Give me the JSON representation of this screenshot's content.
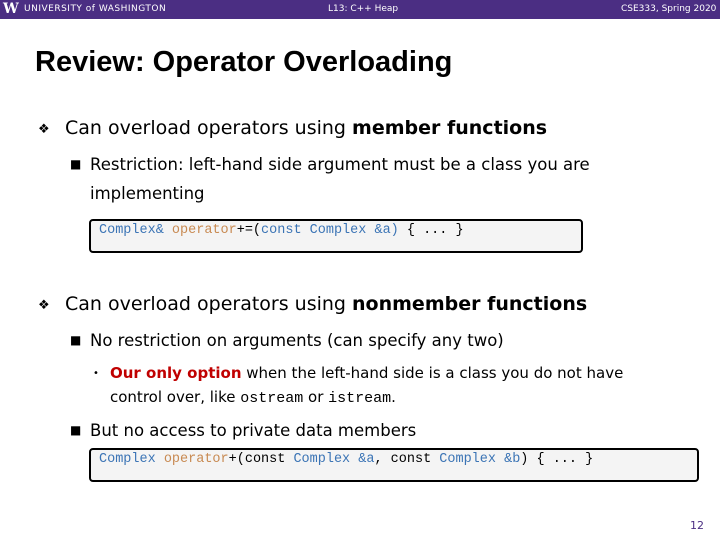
{
  "header": {
    "logo": "W",
    "university": "UNIVERSITY of WASHINGTON",
    "lecture": "L13: C++ Heap",
    "course": "CSE333, Spring 2020"
  },
  "title": "Review: Operator Overloading",
  "bullet1": {
    "pre": "Can overload operators using ",
    "bold": "member functions"
  },
  "bullet1_sub": "Restriction: left-hand side argument must be a class you are implementing",
  "code1": [
    {
      "t": "Complex&",
      "c": "k"
    },
    {
      "t": " ",
      "c": "p"
    },
    {
      "t": "operator",
      "c": "o"
    },
    {
      "t": "+=(",
      "c": "p"
    },
    {
      "t": "const Complex &a)",
      "c": "k"
    },
    {
      "t": " { ... }",
      "c": "p"
    }
  ],
  "bullet2": {
    "pre": "Can overload operators using ",
    "bold": "nonmember functions"
  },
  "bullet2_sub1": "No restriction on arguments (can specify any two)",
  "bullet2_sub1_sub": {
    "red": "Our only option",
    "mid": " when the left-hand side is a class you do not have control over, like ",
    "c1": "ostream",
    "or": " or ",
    "c2": "istream",
    "end": "."
  },
  "bullet2_sub2": "But no access to private data members",
  "code2": [
    {
      "t": "Complex",
      "c": "k"
    },
    {
      "t": " ",
      "c": "p"
    },
    {
      "t": "operator",
      "c": "o"
    },
    {
      "t": "+(const ",
      "c": "p"
    },
    {
      "t": "Complex &a",
      "c": "k"
    },
    {
      "t": ", const ",
      "c": "p"
    },
    {
      "t": "Complex &b",
      "c": "k"
    },
    {
      "t": ") { ... }",
      "c": "p"
    }
  ],
  "colors": {
    "header": "#4b2e83",
    "keyword": "#3b74b5",
    "operator": "#c88a52",
    "highlight": "#c00000"
  },
  "page_number": "12"
}
